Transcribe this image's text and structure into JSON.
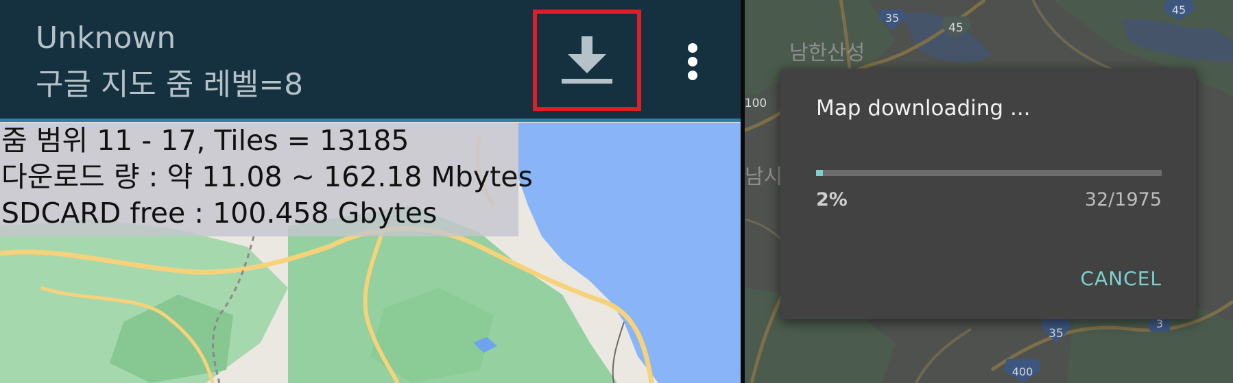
{
  "toolbar": {
    "title": "Unknown",
    "subtitle": "구글 지도 줌 레벨=8"
  },
  "info": {
    "zoom_range": "줌 범위 11 - 17, Tiles = 13185",
    "download_size": "다운로드 량 : 약 11.08 ~ 162.18 Mbytes",
    "sdcard_free": "SDCARD free : 100.458 Gbytes"
  },
  "right_map": {
    "place_label_top": "남한산성",
    "place_label_mid": "남시",
    "shields": [
      "35",
      "45",
      "45",
      "100",
      "35",
      "400",
      "3"
    ]
  },
  "dialog": {
    "title": "Map downloading ...",
    "percent_text": "2%",
    "progress_fraction": 0.02,
    "count_text": "32/1975",
    "cancel_label": "CANCEL"
  },
  "colors": {
    "toolbar": "#15313f",
    "accent_line": "#2e7fa5",
    "highlight_box": "#e11d2b",
    "dialog_bg": "#424242",
    "progress_fill": "#7fd0cf",
    "water": "#8ab4f8",
    "map_green": "#8fcf9a"
  },
  "icons": {
    "download": "download-icon",
    "more": "more-vert-icon"
  }
}
